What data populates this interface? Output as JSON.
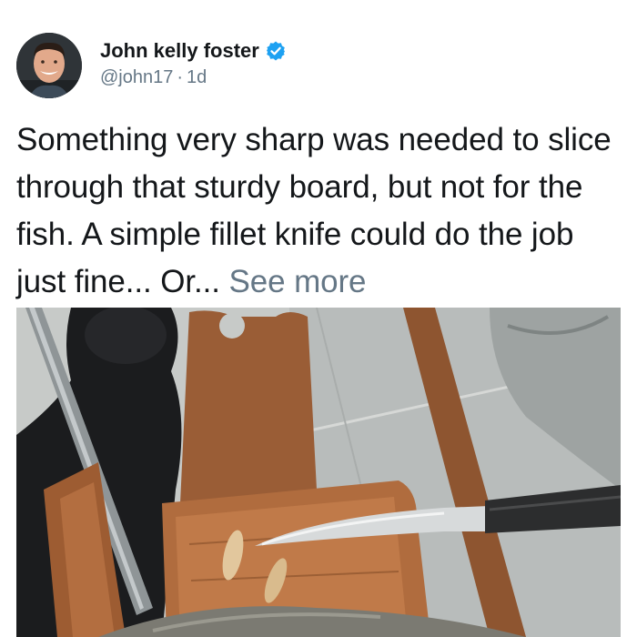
{
  "author": {
    "name": "John kelly foster",
    "handle": "@john17",
    "separator": "·",
    "time": "1d",
    "verified_icon": "verified-badge-icon",
    "avatar_icon": "avatar-photo"
  },
  "tweet": {
    "text": "Something very sharp was needed to slice through that sturdy board, but not for the fish. A simple fillet knife could do the job just fine... Or...",
    "see_more": "See more"
  },
  "colors": {
    "verified_blue": "#1da1f2",
    "secondary_text": "#657786",
    "primary_text": "#14171a"
  }
}
